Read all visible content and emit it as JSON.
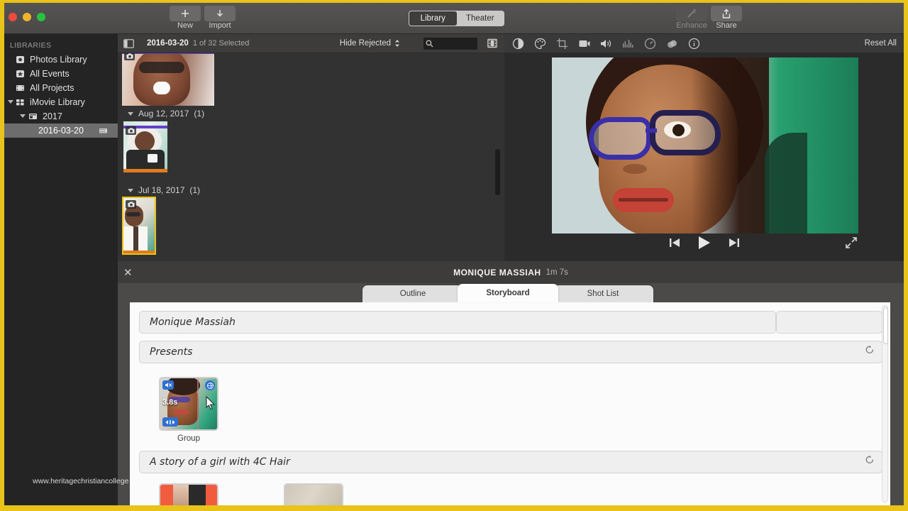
{
  "window": {
    "traffic_lights": [
      "close",
      "minimize",
      "maximize"
    ]
  },
  "toolbar": {
    "new_label": "New",
    "import_label": "Import",
    "enhance_label": "Enhance",
    "share_label": "Share",
    "mode_tabs": [
      {
        "label": "Library",
        "selected": true
      },
      {
        "label": "Theater",
        "selected": false
      }
    ]
  },
  "sidebar": {
    "header": "LIBRARIES",
    "items": [
      {
        "label": "Photos Library",
        "icon": "photos-icon",
        "level": 1,
        "selected": false
      },
      {
        "label": "All Events",
        "icon": "star-icon",
        "level": 1,
        "selected": false
      },
      {
        "label": "All Projects",
        "icon": "projects-icon",
        "level": 1,
        "selected": false
      },
      {
        "label": "iMovie Library",
        "icon": "library-icon",
        "level": 1,
        "selected": false,
        "expanded": true
      },
      {
        "label": "2017",
        "icon": "year-icon",
        "level": 2,
        "selected": false,
        "expanded": true
      },
      {
        "label": "2016-03-20",
        "icon": "event-icon",
        "level": 3,
        "selected": true
      }
    ]
  },
  "browser": {
    "date": "2016-03-20",
    "selection": "1 of 32 Selected",
    "filter_label": "Hide Rejected",
    "search_placeholder": "",
    "search_value": "",
    "groups": [
      {
        "title": "",
        "count": "",
        "clips": [
          {
            "label": "",
            "favorited": false,
            "selected": false
          }
        ]
      },
      {
        "title": "Aug 12, 2017",
        "count": "(1)",
        "clips": [
          {
            "label": "",
            "favorited": true,
            "selected": false
          }
        ]
      },
      {
        "title": "Jul 18, 2017",
        "count": "(1)",
        "clips": [
          {
            "label": "",
            "favorited": true,
            "selected": true
          }
        ]
      }
    ]
  },
  "viewer": {
    "adjust_icons": [
      "color-balance-icon",
      "color-correction-icon",
      "crop-icon",
      "stabilization-icon",
      "volume-icon",
      "equalizer-icon",
      "speed-icon",
      "filters-icon",
      "info-icon"
    ],
    "reset_label": "Reset All",
    "playback": [
      "previous-icon",
      "play-icon",
      "next-icon",
      "fullscreen-icon"
    ]
  },
  "trailer": {
    "title": "MONIQUE MASSIAH",
    "duration": "1m 7s",
    "close_label": "✕",
    "tabs": [
      {
        "label": "Outline",
        "selected": false
      },
      {
        "label": "Storyboard",
        "selected": true
      },
      {
        "label": "Shot List",
        "selected": false
      }
    ],
    "storyboard": {
      "fields": [
        {
          "value": "Monique Massiah",
          "split": true,
          "revert": false
        },
        {
          "value": "Presents",
          "split": false,
          "revert": true
        },
        {
          "value": "A story of a girl with 4C Hair",
          "split": false,
          "revert": true
        }
      ],
      "clip": {
        "label": "Group",
        "duration": "3.8s",
        "badges": [
          "mute-icon",
          "rotate-icon",
          "speed-icon"
        ]
      }
    }
  },
  "watermark": "www.heritagechristiancollege",
  "colors": {
    "accent_yellow": "#e8c319",
    "selection_purple": "#6340c8",
    "favorite_orange": "#e07b20",
    "badge_blue": "#2f6fd0"
  }
}
